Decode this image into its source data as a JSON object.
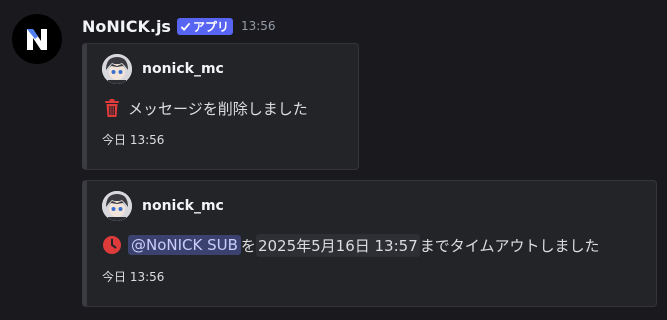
{
  "message": {
    "author": "NoNICK.js",
    "app_tag": "アプリ",
    "time": "13:56",
    "accent_color": "#5865f2"
  },
  "embeds": [
    {
      "author_name": "nonick_mc",
      "icon": "trash-icon",
      "icon_color": "#e03b3b",
      "text": "メッセージを削除しました",
      "footer": "今日 13:56"
    },
    {
      "author_name": "nonick_mc",
      "icon": "clock-icon",
      "icon_color": "#e03b3b",
      "mention": "@NoNICK SUB",
      "joiner": "を",
      "timestamp": "2025年5月16日 13:57",
      "suffix": "までタイムアウトしました",
      "footer": "今日 13:56"
    }
  ]
}
